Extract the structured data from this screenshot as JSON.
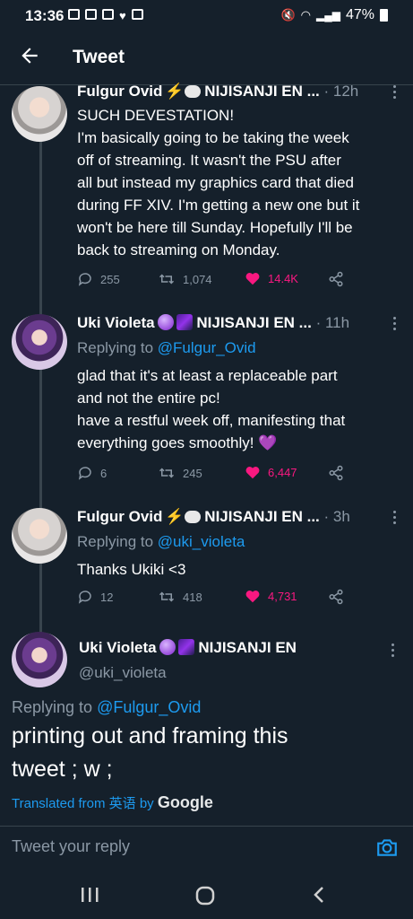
{
  "status": {
    "time": "13:36",
    "battery": "47%"
  },
  "header": {
    "title": "Tweet"
  },
  "tweets": [
    {
      "name": "Fulgur Ovid",
      "org": "NIJISANJI EN ...",
      "time": "· 12h",
      "text_lines": [
        "SUCH DEVESTATION!",
        "I'm basically going to be taking the week",
        "off of streaming. It wasn't the PSU after",
        "all but instead my graphics card that died",
        "during FF XIV. I'm getting a new one but it",
        "won't be here till Sunday. Hopefully I'll be",
        "back to streaming on Monday."
      ],
      "replies": "255",
      "retweets": "1,074",
      "likes": "14.4K"
    },
    {
      "name": "Uki Violeta",
      "org": "NIJISANJI EN ...",
      "time": "· 11h",
      "replying_label": "Replying to ",
      "replying_handle": "@Fulgur_Ovid",
      "text_lines": [
        "glad that it's at least a replaceable part",
        "and not the entire pc!",
        "have a restful week off, manifesting that",
        "everything goes smoothly! 💜"
      ],
      "replies": "6",
      "retweets": "245",
      "likes": "6,447"
    },
    {
      "name": "Fulgur Ovid",
      "org": "NIJISANJI EN ...",
      "time": "· 3h",
      "replying_label": "Replying to ",
      "replying_handle": "@uki_violeta",
      "text_lines": [
        "Thanks Ukiki <3"
      ],
      "replies": "12",
      "retweets": "418",
      "likes": "4,731"
    }
  ],
  "main_tweet": {
    "name": "Uki Violeta",
    "org": "NIJISANJI EN",
    "handle": "@uki_violeta",
    "replying_label": "Replying to ",
    "replying_handle": "@Fulgur_Ovid",
    "text_line1": "printing out and framing this",
    "text_line2": "tweet ; w ;",
    "translated_label": "Translated from 英语 by ",
    "translated_service": "Google"
  },
  "reply_bar": {
    "placeholder": "Tweet your reply"
  },
  "colors": {
    "background": "#15202b",
    "accent": "#1d9bf0",
    "like": "#f91880",
    "muted": "#8b98a5"
  }
}
